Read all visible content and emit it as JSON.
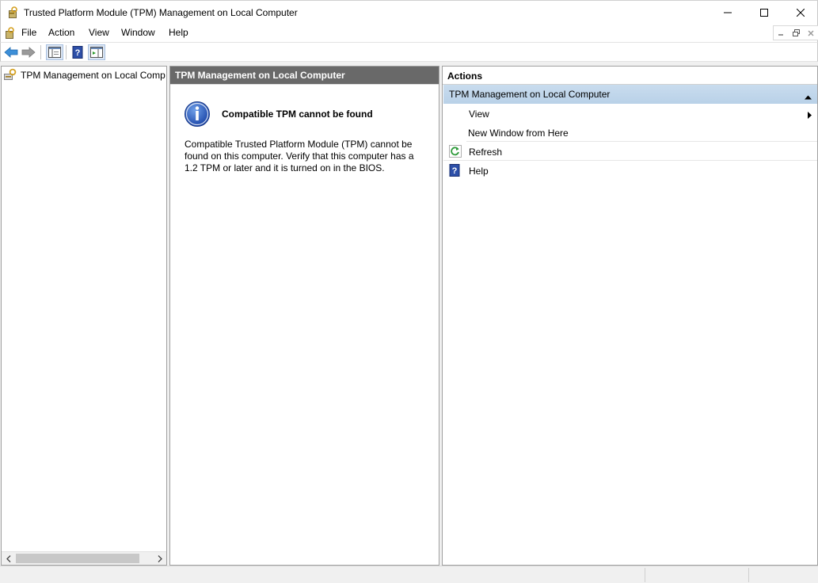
{
  "window": {
    "title": "Trusted Platform Module (TPM) Management on Local Computer"
  },
  "menu": {
    "items": [
      "File",
      "Action",
      "View",
      "Window",
      "Help"
    ]
  },
  "tree": {
    "root_label": "TPM Management on Local Comp"
  },
  "center": {
    "header": "TPM Management on Local Computer",
    "message_title": "Compatible TPM cannot be found",
    "message_body": "Compatible Trusted Platform Module (TPM) cannot be found on this computer. Verify that this computer has a 1.2 TPM or later and it is turned on in the BIOS."
  },
  "actions": {
    "header": "Actions",
    "section_title": "TPM Management on Local Computer",
    "items": [
      "View",
      "New Window from Here",
      "Refresh",
      "Help"
    ]
  },
  "colors": {
    "header_bg": "#696969",
    "section_bg": "#c3d8ec",
    "nav_arrow": "#3c8fd8"
  }
}
